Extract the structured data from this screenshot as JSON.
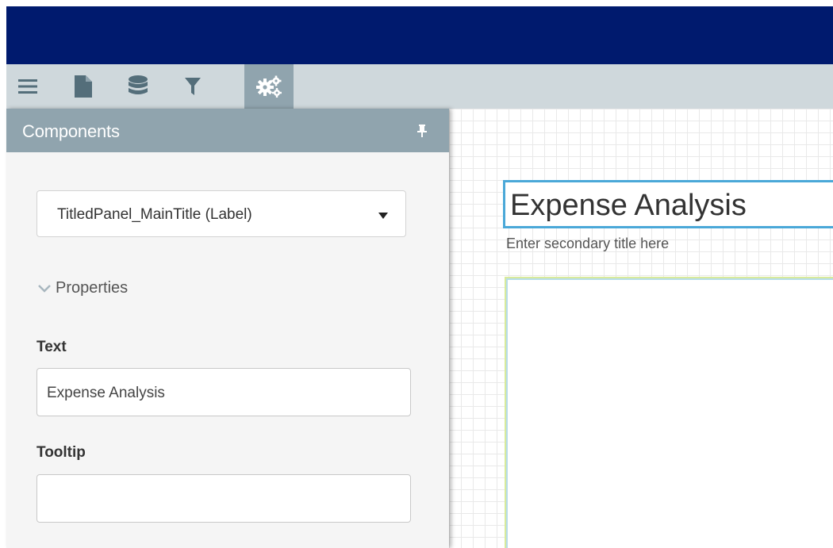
{
  "toolbar": {
    "items": [
      {
        "icon": "menu-icon"
      },
      {
        "icon": "document-icon"
      },
      {
        "icon": "database-icon"
      },
      {
        "icon": "filter-icon"
      },
      {
        "icon": "gears-icon",
        "active": true
      }
    ]
  },
  "panel": {
    "title": "Components",
    "pin_icon": "pin-icon"
  },
  "component_select": {
    "value": "TitledPanel_MainTitle (Label)"
  },
  "properties": {
    "header": "Properties",
    "text_label": "Text",
    "text_value": "Expense Analysis",
    "tooltip_label": "Tooltip",
    "tooltip_value": ""
  },
  "canvas": {
    "main_title": "Expense Analysis",
    "secondary_title": "Enter secondary title here"
  },
  "colors": {
    "topbar": "#001a6e",
    "toolbar": "#cfd8dc",
    "panel_header": "#90a4ae",
    "selection_border": "#4aa8d8"
  }
}
